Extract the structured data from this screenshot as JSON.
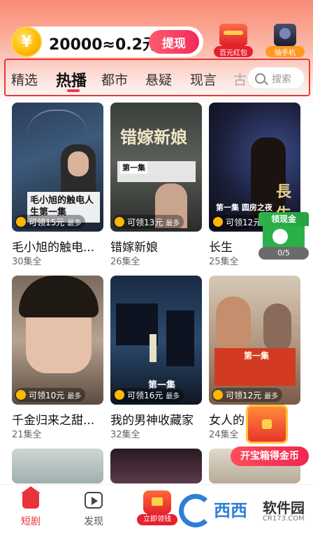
{
  "header": {
    "coin_symbol": "¥",
    "coin_text": "20000≈0.2元",
    "withdraw_label": "提现",
    "promo_red_packet": "百元红包",
    "promo_phone": "抽手机"
  },
  "tabs": [
    {
      "label": "精选"
    },
    {
      "label": "热播"
    },
    {
      "label": "都市"
    },
    {
      "label": "悬疑"
    },
    {
      "label": "现言"
    },
    {
      "label": "古"
    }
  ],
  "search": {
    "placeholder": "搜索"
  },
  "cards": [
    {
      "title": "毛小旭的触电...",
      "episodes": "30集全",
      "reward": "可领15元",
      "max": "最多",
      "overlay": "毛小旭的触电人生第一集"
    },
    {
      "title": "错嫁新娘",
      "episodes": "26集全",
      "reward": "可领13元",
      "max": "最多",
      "overlay": "错嫁新娘",
      "overlay2": "第一集"
    },
    {
      "title": "长生",
      "episodes": "25集全",
      "reward": "可领12元",
      "max": "最多",
      "overlay": "長生",
      "overlay2": "第一集 圆房之夜"
    },
    {
      "title": "千金归来之甜...",
      "episodes": "21集全",
      "reward": "可领10元",
      "max": "最多"
    },
    {
      "title": "我的男神收藏家",
      "episodes": "32集全",
      "reward": "可领16元",
      "max": "最多",
      "overlay": "第一集"
    },
    {
      "title": "女人的",
      "episodes": "24集全",
      "reward": "可领12元",
      "max": "最多",
      "overlay": "第一集"
    }
  ],
  "floating": {
    "cash_label": "领现金",
    "cash_progress": "0/5",
    "chest_label": "开宝箱得金币"
  },
  "bottom_nav": {
    "short_drama": "短剧",
    "discover": "发现",
    "earn": "立即领钱"
  },
  "watermark": {
    "brand": "西西",
    "text": "软件园",
    "url": "CR173.COM"
  }
}
